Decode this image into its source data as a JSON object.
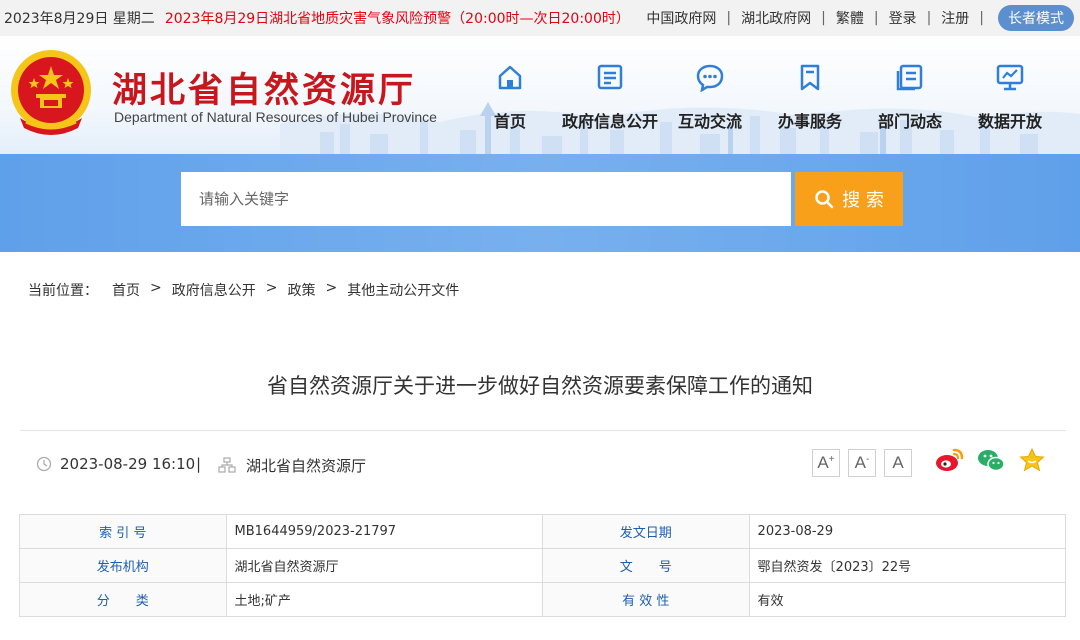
{
  "topbar": {
    "date": "2023年8月29日 星期二",
    "alert": "2023年8月29日湖北省地质灾害气象风险预警（20:00时—次日20:00时）",
    "links": [
      "中国政府网",
      "湖北政府网",
      "繁體",
      "登录",
      "注册"
    ],
    "elder_mode": "长者模式"
  },
  "header": {
    "title": "湖北省自然资源厅",
    "subtitle": "Department of Natural Resources of Hubei Province",
    "nav": [
      {
        "label": "首页",
        "icon": "home-icon"
      },
      {
        "label": "政府信息公开",
        "icon": "document-icon"
      },
      {
        "label": "互动交流",
        "icon": "chat-icon"
      },
      {
        "label": "办事服务",
        "icon": "bookmark-icon"
      },
      {
        "label": "部门动态",
        "icon": "news-icon"
      },
      {
        "label": "数据开放",
        "icon": "data-icon"
      }
    ]
  },
  "search": {
    "placeholder": "请输入关键字",
    "button_label": "搜 索"
  },
  "breadcrumb": {
    "lead": "当前位置：",
    "items": [
      "首页",
      "政府信息公开",
      "政策",
      "其他主动公开文件"
    ],
    "separator": ">"
  },
  "article": {
    "title": "省自然资源厅关于进一步做好自然资源要素保障工作的通知",
    "time": "2023-08-29 16:10",
    "separator": "|",
    "org": "湖北省自然资源厅",
    "font_buttons": [
      "A",
      "A",
      "A"
    ],
    "font_marks": [
      "+",
      "-",
      ""
    ]
  },
  "info": {
    "rows": [
      [
        {
          "k": "索 引 号",
          "v": "MB1644959/2023-21797"
        },
        {
          "k": "发文日期",
          "v": "2023-08-29"
        }
      ],
      [
        {
          "k": "发布机构",
          "v": "湖北省自然资源厅"
        },
        {
          "k": "文　　号",
          "v": "鄂自然资发〔2023〕22号"
        }
      ],
      [
        {
          "k": "分　　类",
          "v": "土地;矿产"
        },
        {
          "k": "有 效 性",
          "v": "有效"
        }
      ]
    ]
  },
  "colors": {
    "brand_red": "#c8161d",
    "alert_red": "#e60012",
    "nav_blue": "#2f7fd8",
    "search_band": "#6aa8ec",
    "search_button": "#f9a01b",
    "key_blue": "#1d5eb0"
  }
}
